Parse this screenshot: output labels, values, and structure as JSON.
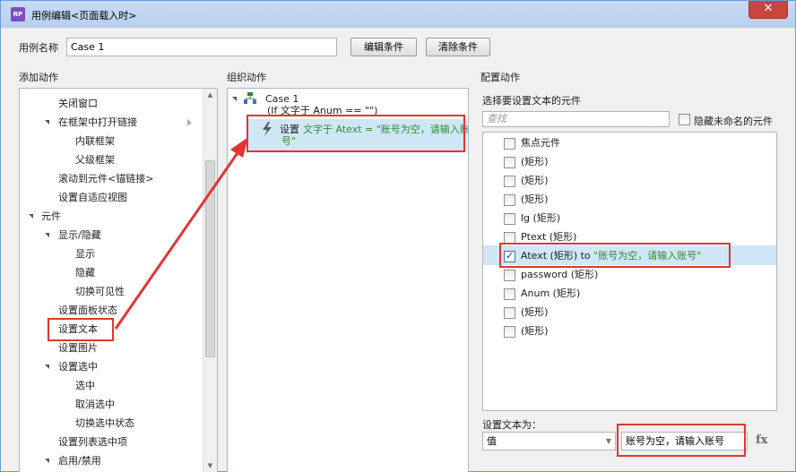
{
  "window": {
    "app_icon": "RP",
    "title": "用例编辑<页面载入时>",
    "close_glyph": "✕"
  },
  "case_name": {
    "label": "用例名称",
    "value": "Case 1",
    "edit_button": "编辑条件",
    "clear_button": "清除条件"
  },
  "add_actions": {
    "header": "添加动作",
    "items": [
      {
        "label": "关闭窗口"
      },
      {
        "label": "在框架中打开链接"
      },
      {
        "label": "内联框架"
      },
      {
        "label": "父级框架"
      },
      {
        "label": "滚动到元件<锚链接>"
      },
      {
        "label": "设置自适应视图"
      },
      {
        "label": "元件"
      },
      {
        "label": "显示/隐藏"
      },
      {
        "label": "显示"
      },
      {
        "label": "隐藏"
      },
      {
        "label": "切换可见性"
      },
      {
        "label": "设置面板状态"
      },
      {
        "label": "设置文本"
      },
      {
        "label": "设置图片"
      },
      {
        "label": "设置选中"
      },
      {
        "label": "选中"
      },
      {
        "label": "取消选中"
      },
      {
        "label": "切换选中状态"
      },
      {
        "label": "设置列表选中项"
      },
      {
        "label": "启用/禁用"
      }
    ]
  },
  "organize_actions": {
    "header": "组织动作",
    "case_title": "Case 1",
    "case_condition": "(If 文字于 Anum == \"\")",
    "action_prefix": "设置",
    "action_line1": "文字于 Atext = \"账号为空，请输入账",
    "action_line2": "号\""
  },
  "configure_actions": {
    "header": "配置动作",
    "select_label": "选择要设置文本的元件",
    "search_placeholder": "查找",
    "hide_unnamed_label": "隐藏未命名的元件",
    "widgets": [
      {
        "label": "焦点元件",
        "checked": false
      },
      {
        "label": "(矩形)",
        "checked": false
      },
      {
        "label": "(矩形)",
        "checked": false
      },
      {
        "label": "(矩形)",
        "checked": false
      },
      {
        "label": "lg (矩形)",
        "checked": false
      },
      {
        "label": "Ptext (矩形)",
        "checked": false
      },
      {
        "label": "Atext (矩形) to ",
        "value": "\"账号为空，请输入账号\"",
        "checked": true
      },
      {
        "label": "password (矩形)",
        "checked": false
      },
      {
        "label": "Anum (矩形)",
        "checked": false
      },
      {
        "label": "(矩形)",
        "checked": false
      },
      {
        "label": "(矩形)",
        "checked": false
      }
    ],
    "set_text_label": "设置文本为：",
    "value_type": "值",
    "text_value": "账号为空，请输入账号",
    "fx_label": "fx"
  },
  "colors": {
    "highlight": "#cfe7f6",
    "annotation_red": "#e03535",
    "value_green": "#2f8a2f"
  }
}
